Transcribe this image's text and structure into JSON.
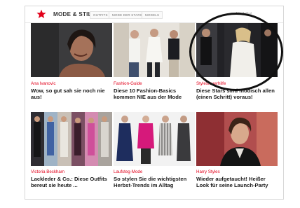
{
  "nav": {
    "brand": "MODE & STIL",
    "tabs": [
      "OUTFITS",
      "MODE DER STARS",
      "MODELS"
    ],
    "link": "Alle Artikel"
  },
  "cards": [
    {
      "category": "Ana Ivanovic",
      "title": "Wow, so gut sah sie noch nie aus!"
    },
    {
      "category": "Fashion-Guide",
      "title": "Diese 10 Fashion-Basics kommen NIE aus der Mode"
    },
    {
      "category": "Stylesteuerhilfe",
      "title": "Diese Stars sind modisch allen (einen Schritt) voraus!"
    },
    {
      "category": "Victoria Beckham",
      "title": "Lackleder & Co.: Diese Outfits bereut sie heute ..."
    },
    {
      "category": "Laufsteg-Mode",
      "title": "So stylen Sie die wichtigsten Herbst-Trends im Alltag"
    },
    {
      "category": "Harry Styles",
      "title": "Wieder aufgetaucht! Heißer Look für seine Launch-Party"
    }
  ],
  "colors": {
    "accent": "#e2001a",
    "text": "#1a1a1a",
    "border": "#d7d7d7",
    "annotation": "#111111"
  },
  "icons": {
    "logo": "red-star-icon"
  }
}
